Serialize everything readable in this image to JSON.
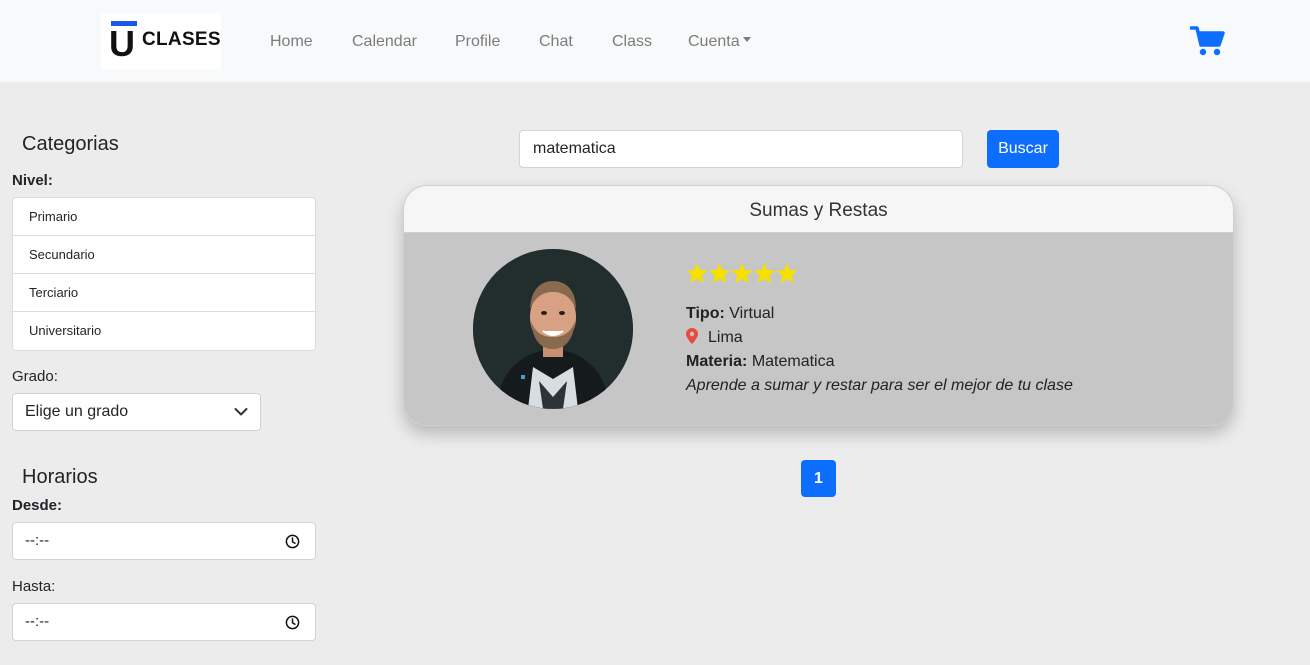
{
  "brand": {
    "logo_letter": "U",
    "logo_text": "CLASES",
    "accent": "#1a56e8"
  },
  "nav": {
    "items": [
      "Home",
      "Calendar",
      "Profile",
      "Chat",
      "Class",
      "Cuenta"
    ],
    "cart_icon": "shopping-cart-icon"
  },
  "sidebar": {
    "categorias_title": "Categorias",
    "nivel_label": "Nivel:",
    "nivel_options": [
      "Primario",
      "Secundario",
      "Terciario",
      "Universitario"
    ],
    "grado_label": "Grado:",
    "grado_select": "Elige un grado",
    "horarios_title": "Horarios",
    "desde_label": "Desde:",
    "desde_value": "--:--",
    "hasta_label": "Hasta:",
    "hasta_value": "--:--"
  },
  "search": {
    "value": "matematica",
    "button_label": "Buscar"
  },
  "card": {
    "title": "Sumas y Restas",
    "rating": 5,
    "rating_max": 5,
    "tipo_label": "Tipo:",
    "tipo_value": "Virtual",
    "location": "Lima",
    "materia_label": "Materia:",
    "materia_value": "Matematica",
    "description": "Aprende a sumar y restar para ser el mejor de tu clase"
  },
  "pagination": {
    "current": "1"
  },
  "colors": {
    "primary": "#0d6efd",
    "star": "#f5e000",
    "pin": "#e84a3c"
  }
}
